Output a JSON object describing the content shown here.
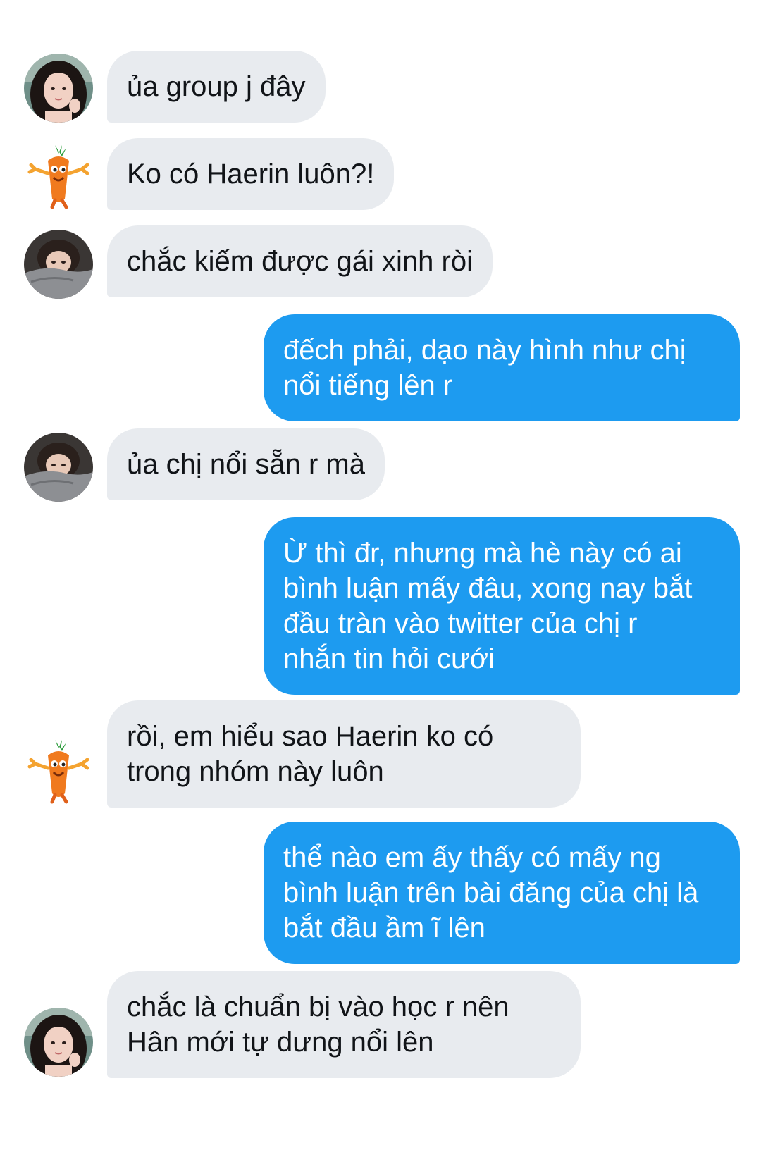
{
  "conversation": {
    "messages": [
      {
        "sender": "girl-long-hair",
        "direction": "in",
        "lines": [
          "ủa group j đây"
        ]
      },
      {
        "sender": "carrot",
        "direction": "in",
        "lines": [
          "Ko có Haerin luôn?!"
        ]
      },
      {
        "sender": "girl-blanket",
        "direction": "in",
        "lines": [
          "chắc kiếm được gái xinh ròi"
        ]
      },
      {
        "sender": "me",
        "direction": "out",
        "lines": [
          "đếch phải, dạo này hình như chị",
          "nổi tiếng lên r"
        ]
      },
      {
        "sender": "girl-blanket",
        "direction": "in",
        "lines": [
          "ủa chị nổi sẵn r mà"
        ]
      },
      {
        "sender": "me",
        "direction": "out",
        "lines": [
          "Ừ thì đr, nhưng mà hè này có ai",
          "bình luận mấy đâu, xong nay bắt",
          "đầu tràn vào twitter của chị r",
          "nhắn tin hỏi cưới"
        ]
      },
      {
        "sender": "carrot",
        "direction": "in",
        "lines": [
          "rồi, em hiểu sao Haerin ko có",
          "trong nhóm này luôn"
        ]
      },
      {
        "sender": "me",
        "direction": "out",
        "lines": [
          "thể nào em ấy thấy có mấy ng",
          "bình luận trên bài đăng của chị là",
          "bắt đầu ầm ĩ lên"
        ]
      },
      {
        "sender": "girl-long-hair",
        "direction": "in",
        "lines": [
          "chắc là chuẩn bị vào học r nên",
          "Hân mới tự dưng nổi lên"
        ]
      }
    ]
  },
  "colors": {
    "incoming_bubble": "#e8ebef",
    "outgoing_bubble": "#1d9bf0",
    "incoming_text": "#111418",
    "outgoing_text": "#ffffff"
  },
  "icons": {
    "girl-long-hair": "avatar-girl-long-hair-icon",
    "girl-blanket": "avatar-girl-blanket-icon",
    "carrot": "avatar-carrot-mascot-icon"
  }
}
